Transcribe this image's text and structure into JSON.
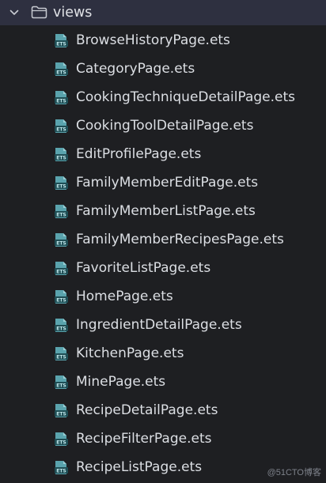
{
  "folder": {
    "name": "views",
    "expanded": true,
    "icon": "folder-icon",
    "chevron": "chevron-down-icon"
  },
  "files": [
    {
      "name": "BrowseHistoryPage.ets",
      "icon": "ets-file-icon",
      "icon_text": "ETS"
    },
    {
      "name": "CategoryPage.ets",
      "icon": "ets-file-icon",
      "icon_text": "ETS"
    },
    {
      "name": "CookingTechniqueDetailPage.ets",
      "icon": "ets-file-icon",
      "icon_text": "ETS"
    },
    {
      "name": "CookingToolDetailPage.ets",
      "icon": "ets-file-icon",
      "icon_text": "ETS"
    },
    {
      "name": "EditProfilePage.ets",
      "icon": "ets-file-icon",
      "icon_text": "ETS"
    },
    {
      "name": "FamilyMemberEditPage.ets",
      "icon": "ets-file-icon",
      "icon_text": "ETS"
    },
    {
      "name": "FamilyMemberListPage.ets",
      "icon": "ets-file-icon",
      "icon_text": "ETS"
    },
    {
      "name": "FamilyMemberRecipesPage.ets",
      "icon": "ets-file-icon",
      "icon_text": "ETS"
    },
    {
      "name": "FavoriteListPage.ets",
      "icon": "ets-file-icon",
      "icon_text": "ETS"
    },
    {
      "name": "HomePage.ets",
      "icon": "ets-file-icon",
      "icon_text": "ETS"
    },
    {
      "name": "IngredientDetailPage.ets",
      "icon": "ets-file-icon",
      "icon_text": "ETS"
    },
    {
      "name": "KitchenPage.ets",
      "icon": "ets-file-icon",
      "icon_text": "ETS"
    },
    {
      "name": "MinePage.ets",
      "icon": "ets-file-icon",
      "icon_text": "ETS"
    },
    {
      "name": "RecipeDetailPage.ets",
      "icon": "ets-file-icon",
      "icon_text": "ETS"
    },
    {
      "name": "RecipeFilterPage.ets",
      "icon": "ets-file-icon",
      "icon_text": "ETS"
    },
    {
      "name": "RecipeListPage.ets",
      "icon": "ets-file-icon",
      "icon_text": "ETS"
    }
  ],
  "watermark": "@51CTO博客",
  "colors": {
    "background": "#1e1f22",
    "selected_row": "#2e3040",
    "text": "#dcdfe4",
    "icon_teal": "#5aa3ad",
    "icon_dark": "#1f4e55"
  }
}
